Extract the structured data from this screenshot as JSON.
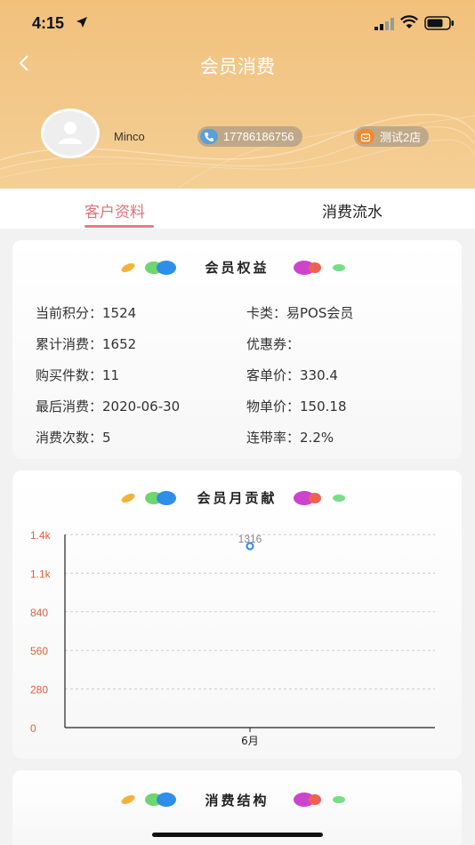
{
  "status_bar": {
    "time": "4:15",
    "icons": [
      "location-arrow-icon",
      "signal-icon",
      "wifi-icon",
      "battery-icon"
    ]
  },
  "nav": {
    "title": "会员消费",
    "back_icon": "chevron-left-icon"
  },
  "profile": {
    "avatar_icon": "default-avatar-icon",
    "name": "Minco",
    "phone": "17786186756",
    "store": "测试2店",
    "phone_icon": "phone-icon",
    "store_icon": "store-icon"
  },
  "tabs": {
    "profile": "客户资料",
    "flow": "消费流水",
    "active": "客户资料"
  },
  "benefits": {
    "title": "会员权益",
    "left": [
      {
        "label": "当前积分：",
        "value": "1524"
      },
      {
        "label": "累计消费：",
        "value": "1652"
      },
      {
        "label": "购买件数：",
        "value": "11"
      },
      {
        "label": "最后消费：",
        "value": "2020-06-30"
      },
      {
        "label": "消费次数：",
        "value": "5"
      }
    ],
    "right": [
      {
        "label": "卡类：",
        "value": "易POS会员"
      },
      {
        "label": "优惠券：",
        "value": ""
      },
      {
        "label": "客单价：",
        "value": "330.4"
      },
      {
        "label": "物单价：",
        "value": "150.18"
      },
      {
        "label": "连带率：",
        "value": "2.2%"
      }
    ]
  },
  "monthly": {
    "title": "会员月贡献"
  },
  "chart_data": {
    "type": "scatter",
    "categories": [
      "6月"
    ],
    "values": [
      1316
    ],
    "ylim": [
      0,
      1400
    ],
    "yticks": [
      "0",
      "280",
      "560",
      "840",
      "1.1k",
      "1.4k"
    ],
    "ytick_values": [
      0,
      280,
      560,
      840,
      1120,
      1400
    ],
    "data_labels": [
      "1316"
    ],
    "grid": true,
    "colors": {
      "axis_label": "#e0603a",
      "point": "#3b8fe8",
      "grid": "#cccccc"
    }
  },
  "structure": {
    "title": "消费结构"
  },
  "colors": {
    "header": "#f3c78a",
    "accent": "#e77b86"
  }
}
